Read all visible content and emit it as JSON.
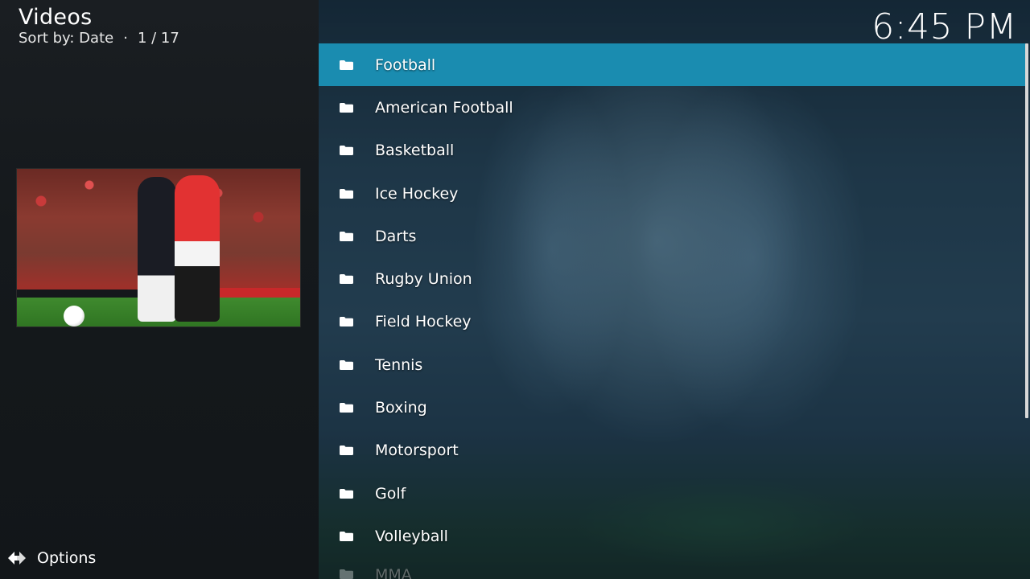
{
  "header": {
    "title": "Videos",
    "sort_label": "Sort by: Date",
    "separator": "·",
    "position": "1 / 17"
  },
  "clock": {
    "time": "6:45 PM"
  },
  "list": {
    "items": [
      {
        "label": "Football",
        "selected": true
      },
      {
        "label": "American Football"
      },
      {
        "label": "Basketball"
      },
      {
        "label": "Ice Hockey"
      },
      {
        "label": "Darts"
      },
      {
        "label": "Rugby Union"
      },
      {
        "label": "Field Hockey"
      },
      {
        "label": "Tennis"
      },
      {
        "label": "Boxing"
      },
      {
        "label": "Motorsport"
      },
      {
        "label": "Golf"
      },
      {
        "label": "Volleyball"
      },
      {
        "label": "MMA"
      }
    ]
  },
  "footer": {
    "options_label": "Options"
  },
  "colors": {
    "selected_bg": "#1a8cb0",
    "sidebar_bg": "#15191c",
    "text": "#ffffff"
  },
  "icons": {
    "folder": "folder-icon",
    "options": "options-arrows-icon"
  }
}
